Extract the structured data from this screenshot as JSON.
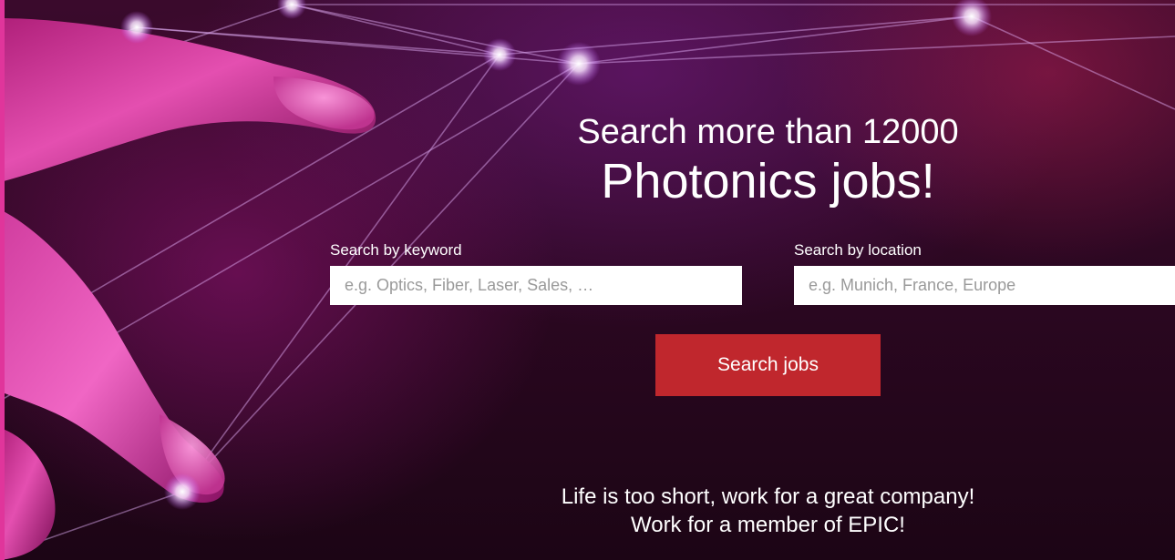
{
  "hero": {
    "headline_line1": "Search more than 12000",
    "headline_line2": "Photonics jobs!"
  },
  "search": {
    "keyword_label": "Search by keyword",
    "keyword_placeholder": "e.g. Optics, Fiber, Laser, Sales, …",
    "keyword_value": "",
    "location_label": "Search by location",
    "location_placeholder": "e.g. Munich, France, Europe",
    "location_value": "",
    "button_label": "Search jobs"
  },
  "tagline": {
    "line1": "Life is too short, work for a great company!",
    "line2": "Work for a member of EPIC!"
  },
  "colors": {
    "accent_button": "#c0272d",
    "background_dark": "#2a0720",
    "edge_pink": "#e0359b"
  },
  "icons": {
    "background": "finger-touching-light-network-image"
  }
}
